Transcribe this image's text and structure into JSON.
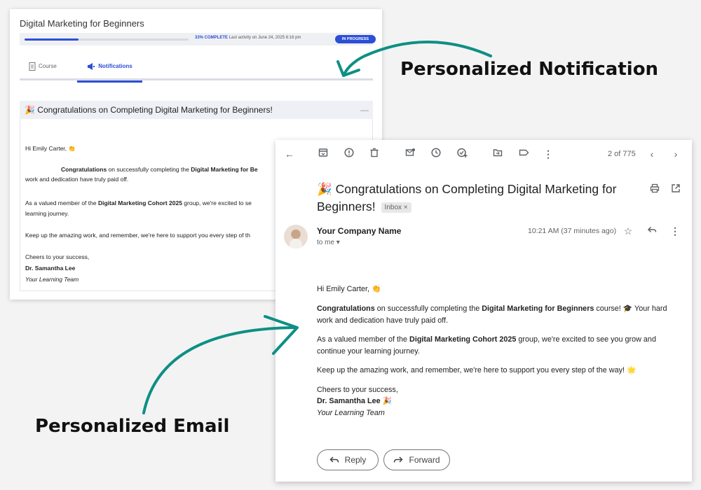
{
  "lms": {
    "course_title": "Digital Marketing for Beginners",
    "progress_percent": 33,
    "progress_label": "33% COMPLETE",
    "last_activity": "Last activity on June 24, 2025 6:16 pm",
    "status": "IN PROGRESS",
    "tabs": [
      {
        "label": "Course",
        "icon": "document-icon"
      },
      {
        "label": "Notifications",
        "icon": "megaphone-icon"
      }
    ],
    "notification": {
      "title": "🎉 Congratulations on Completing Digital Marketing for Beginners!",
      "collapse": "—",
      "greeting": "Hi Emily Carter, 👏",
      "p1_bold": "Congratulations",
      "p1_rest": " on successfully completing the ",
      "p1_course": "Digital Marketing for Be",
      "p1_line2": "work and dedication have truly paid off.",
      "p2_pre": "As a valued member of the ",
      "p2_bold": "Digital Marketing Cohort 2025",
      "p2_rest": " group, we're excited to se",
      "p2_line2": "learning journey.",
      "p3": "Keep up the amazing work, and remember, we're here to support you every step of th",
      "closing": "Cheers to your success,",
      "signer": "Dr. Samantha Lee",
      "team": "Your Learning Team"
    }
  },
  "email": {
    "toolbar_icons": [
      "back-arrow-icon",
      "archive-icon",
      "report-spam-icon",
      "delete-icon",
      "mark-unread-icon",
      "snooze-icon",
      "add-task-icon",
      "move-to-icon",
      "label-icon",
      "more-vert-icon"
    ],
    "pager": "2 of 775",
    "subject": "🎉 Congratulations on Completing Digital Marketing for Beginners!",
    "inbox_label": "Inbox",
    "inbox_close": "×",
    "sender": "Your Company Name",
    "to": "to me",
    "time": "10:21 AM (37 minutes ago)",
    "body": {
      "greeting": "Hi Emily Carter, 👏",
      "p1_bold": "Congratulations",
      "p1_mid": " on successfully completing the ",
      "p1_course": "Digital Marketing for Beginners",
      "p1_end": " course! 🎓 Your hard",
      "p1_line2": "work and dedication have truly paid off.",
      "p2_pre": "As a valued member of the ",
      "p2_bold": "Digital Marketing Cohort 2025",
      "p2_end": " group, we're excited to see you grow and",
      "p2_line2": "continue your learning journey.",
      "p3": "Keep up the amazing work, and remember, we're here to support you every step of the way! 🌟",
      "closing": "Cheers to your success,",
      "signer": "Dr. Samantha Lee 🎉",
      "team": "Your Learning Team"
    },
    "reply_label": "Reply",
    "forward_label": "Forward"
  },
  "callouts": {
    "notification": "Personalized Notification",
    "email": "Personalized Email"
  },
  "colors": {
    "accent_blue": "#2d4fd6",
    "arrow_teal": "#0e8f84"
  }
}
